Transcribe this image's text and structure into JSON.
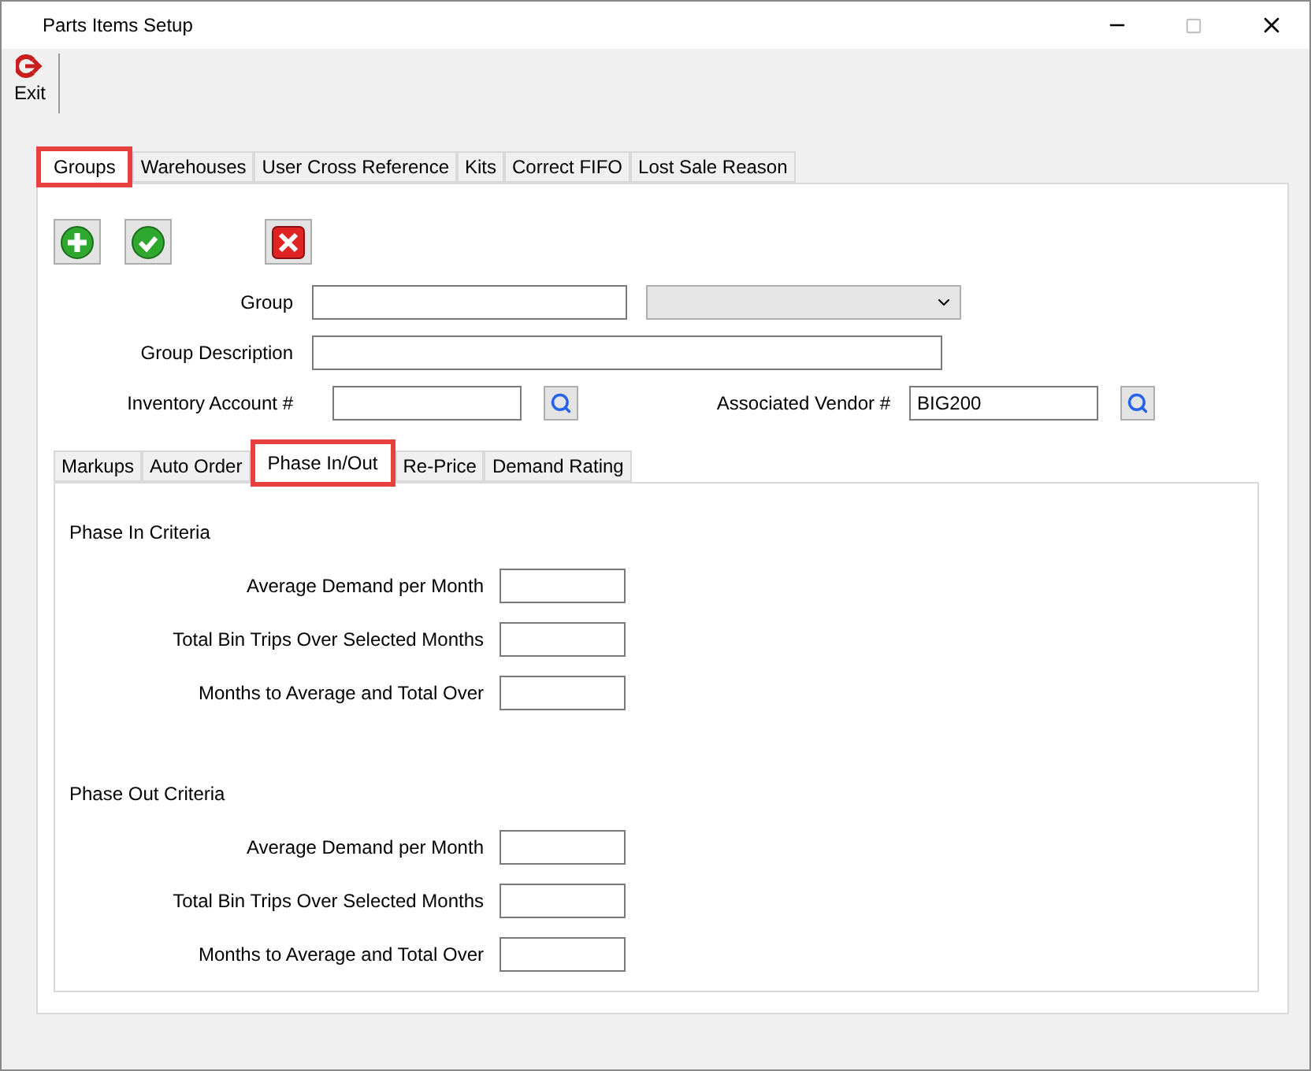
{
  "window": {
    "title": "Parts Items Setup"
  },
  "toolbar": [
    {
      "label": "Exit",
      "kind": "exit"
    }
  ],
  "tabs": [
    {
      "label": "Groups",
      "selected": true
    },
    {
      "label": "Warehouses",
      "selected": false
    },
    {
      "label": "User Cross Reference",
      "selected": false
    },
    {
      "label": "Kits",
      "selected": false
    },
    {
      "label": "Correct FIFO",
      "selected": false
    },
    {
      "label": "Lost Sale Reason",
      "selected": false
    }
  ],
  "actions": [
    {
      "kind": "add"
    },
    {
      "kind": "save"
    },
    {
      "kind": "delete"
    }
  ],
  "form": {
    "group": {
      "label": "Group"
    },
    "group_description": {
      "label": "Group Description"
    },
    "inventory_account": {
      "label": "Inventory Account #"
    },
    "associated_vendor": {
      "label": "Associated Vendor #",
      "value": "BIG200"
    }
  },
  "subtabs": [
    {
      "label": "Markups",
      "selected": false
    },
    {
      "label": "Auto Order",
      "selected": false
    },
    {
      "label": "Phase In/Out",
      "selected": true
    },
    {
      "label": "Re-Price",
      "selected": false
    },
    {
      "label": "Demand Rating",
      "selected": false
    }
  ],
  "sections": [
    {
      "title": "Phase In Criteria",
      "fields": [
        "Average Demand per Month",
        "Total Bin Trips Over Selected Months",
        "Months to Average and Total Over"
      ]
    },
    {
      "title": "Phase Out Criteria",
      "fields": [
        "Average Demand per Month",
        "Total Bin Trips Over Selected Months",
        "Months to Average and Total Over"
      ]
    }
  ]
}
